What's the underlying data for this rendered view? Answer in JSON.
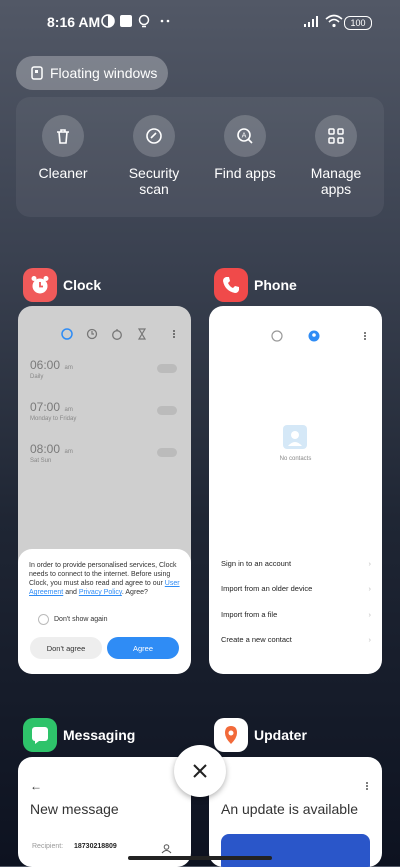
{
  "status_bar": {
    "time": "8:16 AM",
    "battery": "100"
  },
  "floating_windows": {
    "label": "Floating windows"
  },
  "tools": [
    {
      "label": "Cleaner",
      "icon": "trash-icon"
    },
    {
      "label": "Security scan",
      "icon": "shield-check-icon"
    },
    {
      "label": "Find apps",
      "icon": "search-a-icon"
    },
    {
      "label": "Manage apps",
      "icon": "grid-icon"
    }
  ],
  "apps": {
    "clock": {
      "name": "Clock",
      "alarms": [
        {
          "time": "06:00",
          "ampm": "am",
          "sub": "Daily"
        },
        {
          "time": "07:00",
          "ampm": "am",
          "sub": "Monday to Friday"
        },
        {
          "time": "08:00",
          "ampm": "am",
          "sub": "Sat Sun"
        }
      ],
      "dialog": {
        "text_1": "In order to provide personalised services, Clock needs to connect to the internet. Before using Clock, you must also read and agree to our ",
        "link_1": "User Agreement",
        "and": " and ",
        "link_2": "Privacy Policy",
        "text_2": ". Agree?",
        "checkbox_label": "Don't show again",
        "decline": "Don't agree",
        "agree": "Agree"
      }
    },
    "phone": {
      "name": "Phone",
      "empty": "No contacts",
      "menu": [
        "Sign in to an account",
        "Import from an older device",
        "Import from a file",
        "Create a new contact"
      ]
    },
    "messaging": {
      "name": "Messaging",
      "title": "New message",
      "recipient_label": "Recipient:",
      "recipient_value": "18730218809"
    },
    "updater": {
      "name": "Updater",
      "title": "An update is available"
    }
  },
  "colors": {
    "accent": "#2f8cf5",
    "clock_icon": "#f05a5a",
    "phone_icon": "#f04a4a",
    "messaging_icon": "#2ec36a",
    "updater_icon": "#f26a3a"
  }
}
